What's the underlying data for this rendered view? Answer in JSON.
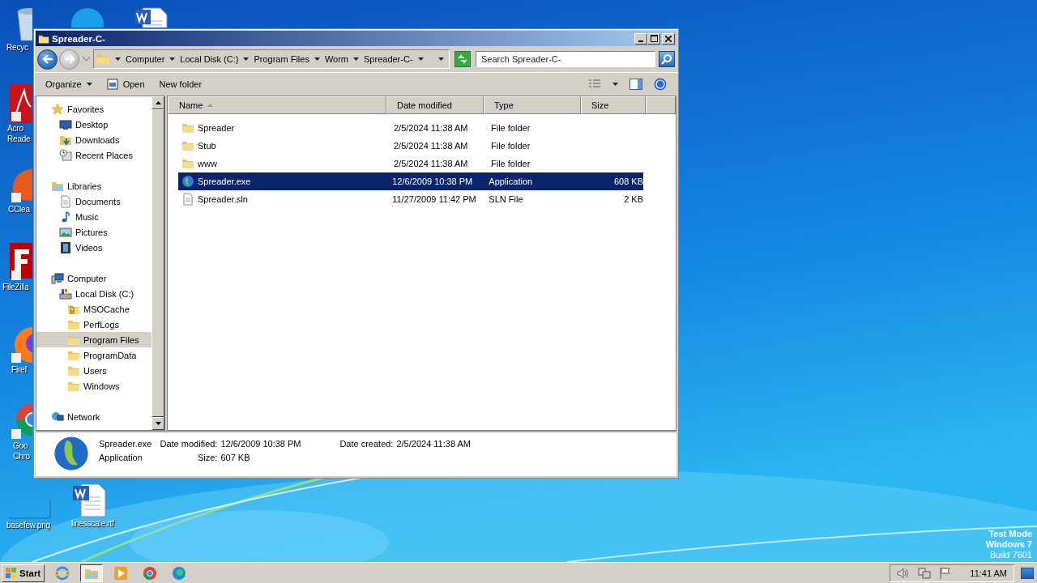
{
  "desktop_icons": [
    {
      "kind": "recycle-bin",
      "label": [
        "Recyc"
      ]
    },
    {
      "kind": "chat-app"
    },
    {
      "kind": "word-doc"
    },
    {
      "kind": "pdf-app",
      "label": [
        "Acro",
        "Reade"
      ]
    },
    {
      "kind": "brush-app",
      "label": [
        "CClea"
      ]
    },
    {
      "kind": "ftp-app",
      "label": [
        "FileZilla"
      ]
    },
    {
      "kind": "fox-app",
      "label": [
        "Firef"
      ]
    },
    {
      "kind": "browser-app",
      "label": [
        "Goo",
        "Chro"
      ]
    },
    {
      "kind": "image-file",
      "label": [
        "basefew.png"
      ]
    },
    {
      "kind": "word-doc",
      "label": [
        "linesscale.rtf"
      ]
    }
  ],
  "window": {
    "title": "Spreader-C-"
  },
  "address": {
    "crumbs": [
      "Computer",
      "Local Disk (C:)",
      "Program Files",
      "Worm",
      "Spreader-C-"
    ]
  },
  "search": {
    "placeholder": "Search Spreader-C-"
  },
  "toolbar": {
    "organize": "Organize",
    "open": "Open",
    "new_folder": "New folder"
  },
  "nav": [
    {
      "kind": "star",
      "label": "Favorites",
      "selected": false,
      "children": [
        {
          "kind": "desktop",
          "label": "Desktop",
          "selected": false
        },
        {
          "kind": "downloads",
          "label": "Downloads",
          "selected": false
        },
        {
          "kind": "recent",
          "label": "Recent Places",
          "selected": false
        }
      ]
    },
    {
      "kind": "library",
      "label": "Libraries",
      "selected": false,
      "children": [
        {
          "kind": "document",
          "label": "Documents",
          "selected": false
        },
        {
          "kind": "music",
          "label": "Music",
          "selected": false
        },
        {
          "kind": "pictures",
          "label": "Pictures",
          "selected": false
        },
        {
          "kind": "videos",
          "label": "Videos",
          "selected": false
        }
      ]
    },
    {
      "kind": "computer",
      "label": "Computer",
      "selected": false,
      "children": [
        {
          "kind": "disk",
          "label": "Local Disk (C:)",
          "selected": false,
          "children": [
            {
              "kind": "locked-folder",
              "label": "MSOCache",
              "selected": false
            },
            {
              "kind": "folder",
              "label": "PerfLogs",
              "selected": false
            },
            {
              "kind": "folder",
              "label": "Program Files",
              "selected": true
            },
            {
              "kind": "folder",
              "label": "ProgramData",
              "selected": false
            },
            {
              "kind": "folder",
              "label": "Users",
              "selected": false
            },
            {
              "kind": "folder",
              "label": "Windows",
              "selected": false
            }
          ]
        }
      ]
    },
    {
      "kind": "network",
      "label": "Network",
      "selected": false
    }
  ],
  "columns": [
    {
      "label": "Name",
      "sorted": true
    },
    {
      "label": "Date modified",
      "sorted": false
    },
    {
      "label": "Type",
      "sorted": false
    },
    {
      "label": "Size",
      "sorted": false
    }
  ],
  "files": [
    {
      "kind": "folder",
      "name": "Spreader",
      "date": "2/5/2024 11:38 AM",
      "type": "File folder",
      "selected": false
    },
    {
      "kind": "folder",
      "name": "Stub",
      "date": "2/5/2024 11:38 AM",
      "type": "File folder",
      "selected": false
    },
    {
      "kind": "folder",
      "name": "www",
      "date": "2/5/2024 11:38 AM",
      "type": "File folder",
      "selected": false
    },
    {
      "kind": "globe",
      "name": "Spreader.exe",
      "date": "12/6/2009 10:38 PM",
      "type": "Application",
      "size": "608 KB",
      "selected": true
    },
    {
      "kind": "document",
      "name": "Spreader.sln",
      "date": "11/27/2009 11:42 PM",
      "type": "SLN File",
      "size": "2 KB",
      "selected": false
    }
  ],
  "details": {
    "name": "Spreader.exe",
    "type": "Application",
    "modified_label": "Date modified:",
    "modified": "12/6/2009 10:38 PM",
    "size_label": "Size:",
    "size": "607 KB",
    "created_label": "Date created:",
    "created": "2/5/2024 11:38 AM"
  },
  "system_text": [
    "Test Mode",
    "Windows 7",
    "Build 7601"
  ],
  "taskbar": {
    "start": "Start",
    "apps": [
      {
        "kind": "ie",
        "selected": false
      },
      {
        "kind": "explorer",
        "selected": true
      },
      {
        "kind": "player",
        "selected": false
      },
      {
        "kind": "chrome",
        "selected": false
      },
      {
        "kind": "edge",
        "selected": false
      }
    ],
    "clock": "11:41 AM"
  }
}
